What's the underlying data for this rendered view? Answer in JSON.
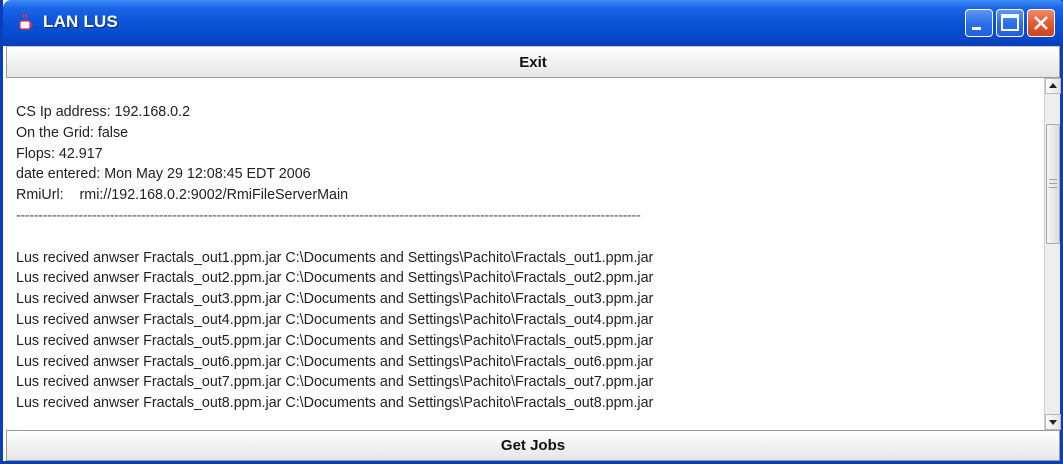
{
  "window": {
    "title": "LAN LUS",
    "accent": "#0a53d8"
  },
  "exit_button": {
    "label": "Exit"
  },
  "get_jobs_button": {
    "label": "Get Jobs"
  },
  "info": {
    "ip_line": "CS Ip address: 192.168.0.2",
    "grid_line": "On the Grid: false",
    "flops_line": "Flops: 42.917",
    "date_line": "date entered: Mon May 29 12:08:45 EDT 2006",
    "rmi_line": "RmiUrl:    rmi://192.168.0.2:9002/RmiFileServerMain",
    "separator": "--------------------------------------------------------------------------------------------------------------------------------------------"
  },
  "log_lines": [
    "Lus recived anwser Fractals_out1.ppm.jar C:\\Documents and Settings\\Pachito\\Fractals_out1.ppm.jar",
    "Lus recived anwser Fractals_out2.ppm.jar C:\\Documents and Settings\\Pachito\\Fractals_out2.ppm.jar",
    "Lus recived anwser Fractals_out3.ppm.jar C:\\Documents and Settings\\Pachito\\Fractals_out3.ppm.jar",
    "Lus recived anwser Fractals_out4.ppm.jar C:\\Documents and Settings\\Pachito\\Fractals_out4.ppm.jar",
    "Lus recived anwser Fractals_out5.ppm.jar C:\\Documents and Settings\\Pachito\\Fractals_out5.ppm.jar",
    "Lus recived anwser Fractals_out6.ppm.jar C:\\Documents and Settings\\Pachito\\Fractals_out6.ppm.jar",
    "Lus recived anwser Fractals_out7.ppm.jar C:\\Documents and Settings\\Pachito\\Fractals_out7.ppm.jar",
    "Lus recived anwser Fractals_out8.ppm.jar C:\\Documents and Settings\\Pachito\\Fractals_out8.ppm.jar"
  ],
  "icons": {
    "app": "java-cup-icon",
    "minimize": "minimize-icon",
    "maximize": "maximize-icon",
    "close": "close-icon",
    "scroll_up": "arrow-up-icon",
    "scroll_down": "arrow-down-icon"
  }
}
